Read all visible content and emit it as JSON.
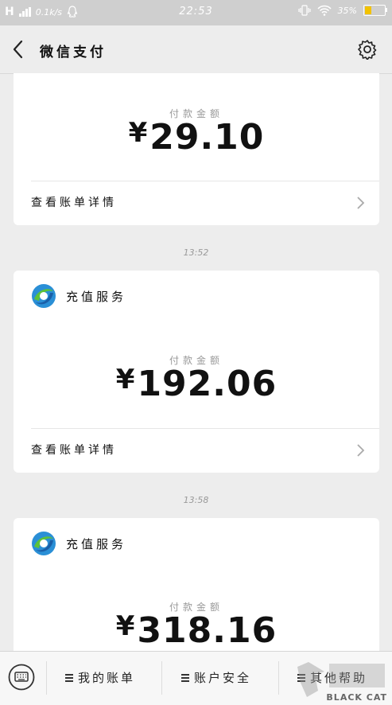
{
  "status_bar": {
    "network": "H",
    "speed": "0.1k/s",
    "time": "22:53",
    "battery": "35%",
    "battery_color": "#f2c200"
  },
  "header": {
    "title": "微信支付"
  },
  "transactions": [
    {
      "service": "",
      "amount_label": "付款金额",
      "currency": "¥",
      "amount": "29.10",
      "detail_link": "查看账单详情"
    },
    {
      "timestamp": "13:52",
      "service": "充值服务",
      "amount_label": "付款金额",
      "currency": "¥",
      "amount": "192.06",
      "detail_link": "查看账单详情"
    },
    {
      "timestamp": "13:58",
      "service": "充值服务",
      "amount_label": "付款金额",
      "currency": "¥",
      "amount": "318.16"
    }
  ],
  "tab_bar": {
    "tabs": [
      {
        "label": "我的账单"
      },
      {
        "label": "账户安全"
      },
      {
        "label": "其他帮助"
      }
    ]
  },
  "watermark": {
    "text": "BLACK CAT"
  },
  "icons": [
    "signal-icon",
    "qq-icon",
    "vibrate-icon",
    "wifi-icon",
    "battery-icon",
    "back-icon",
    "gear-icon",
    "service-logo-icon",
    "chevron-right-icon",
    "keyboard-icon",
    "menu-icon"
  ]
}
